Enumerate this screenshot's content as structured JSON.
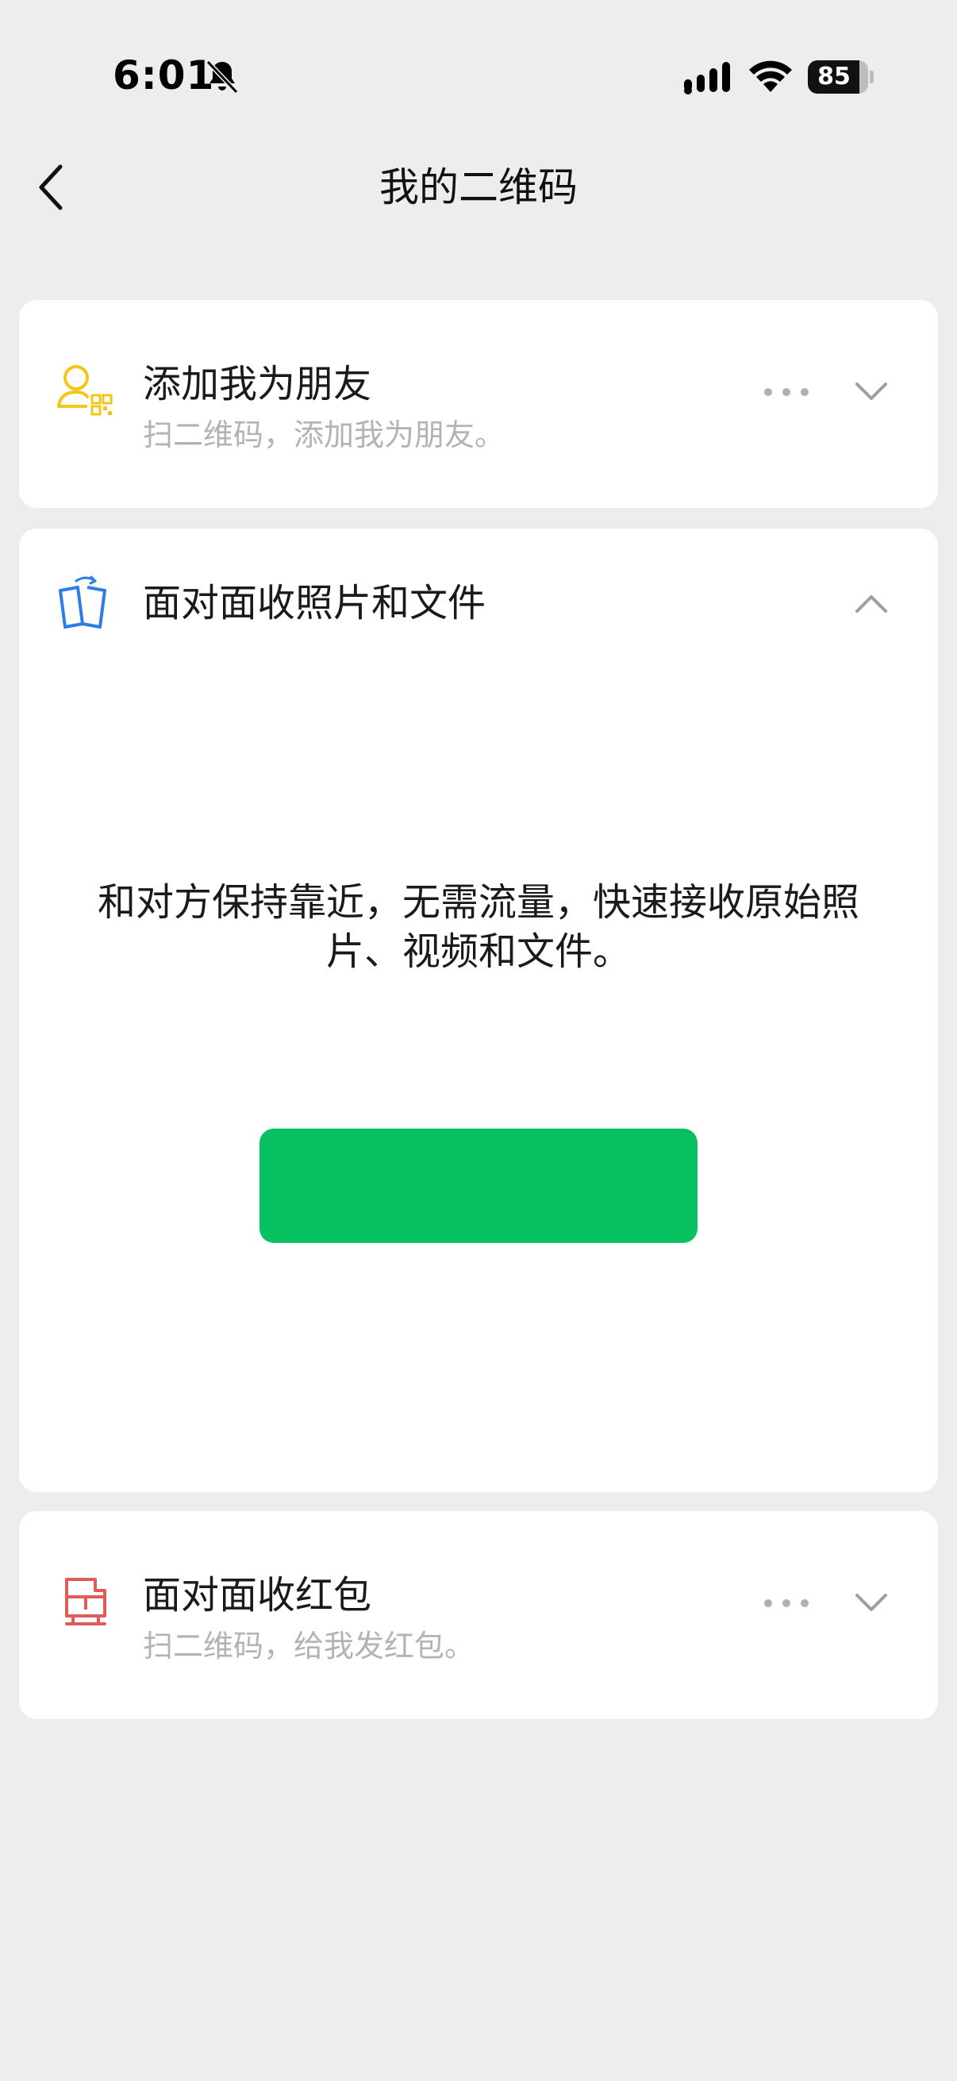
{
  "status_bar": {
    "time": "6:01",
    "battery": "85",
    "battery_level": 0.85,
    "icons": [
      "bell-slash-icon",
      "cellular-signal-icon",
      "wifi-icon",
      "battery-icon"
    ]
  },
  "nav": {
    "title": "我的二维码",
    "back_icon": "chevron-left-icon"
  },
  "cards": [
    {
      "icon": "user-qrcode-icon",
      "title": "添加我为朋友",
      "subtitle": "扫二维码，添加我为朋友。",
      "expanded": false
    },
    {
      "icon": "phone-transfer-icon",
      "title": "面对面收照片和文件",
      "expanded": true,
      "description": "和对方保持靠近，无需流量，快速接收原始照片、视频和文件。"
    },
    {
      "icon": "red-packet-icon",
      "title": "面对面收红包",
      "subtitle": "扫二维码，给我发红包。",
      "expanded": false
    }
  ],
  "colors": {
    "background": "#ededed",
    "card": "#ffffff",
    "accent_green": "#07c160",
    "icon_yellow": "#f5c518",
    "icon_blue": "#2b7de9",
    "icon_red": "#e25b5b",
    "subtitle_gray": "#b3b3b3"
  }
}
